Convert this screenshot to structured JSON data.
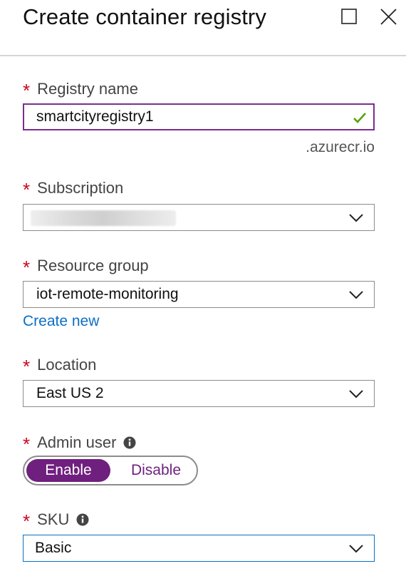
{
  "window": {
    "title": "Create container registry",
    "icons": {
      "maximize": "maximize-icon",
      "close": "close-icon"
    }
  },
  "form": {
    "registry_name": {
      "label": "Registry name",
      "required_mark": "*",
      "value": "smartcityregistry1",
      "suffix": ".azurecr.io",
      "valid": true
    },
    "subscription": {
      "label": "Subscription",
      "required_mark": "*",
      "value_redacted": true
    },
    "resource_group": {
      "label": "Resource group",
      "required_mark": "*",
      "value": "iot-remote-monitoring",
      "create_new_link": "Create new"
    },
    "location": {
      "label": "Location",
      "required_mark": "*",
      "value": "East US 2"
    },
    "admin_user": {
      "label": "Admin user",
      "required_mark": "*",
      "options": [
        "Enable",
        "Disable"
      ],
      "selected": "Enable"
    },
    "sku": {
      "label": "SKU",
      "required_mark": "*",
      "value": "Basic"
    }
  },
  "colors": {
    "required": "#d0021b",
    "accent_purple": "#6f1f7e",
    "link_blue": "#0b6ec5",
    "valid_green": "#57a300",
    "sku_border": "#0a70c0"
  }
}
